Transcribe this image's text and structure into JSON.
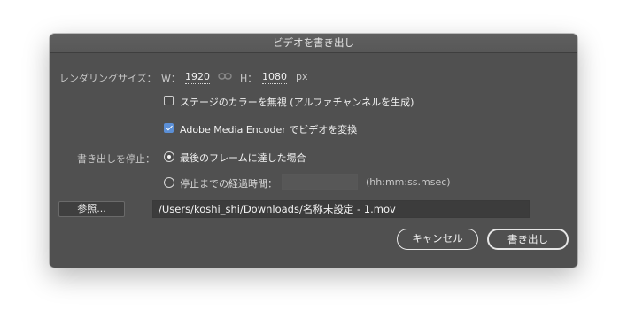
{
  "dialog": {
    "title": "ビデオを書き出し",
    "render_size": {
      "label": "レンダリングサイズ：",
      "w_label": "W：",
      "width": "1920",
      "h_label": "H：",
      "height": "1080",
      "unit": "px"
    },
    "options": {
      "stage_color": {
        "label": "ステージのカラーを無視 (アルファチャンネルを生成)",
        "checked": false
      },
      "media_encoder": {
        "label": "Adobe Media Encoder でビデオを変換",
        "checked": true
      }
    },
    "stop_export": {
      "label": "書き出しを停止：",
      "radios": [
        {
          "label": "最後のフレームに達した場合",
          "selected": true
        },
        {
          "label": "停止までの経過時間：",
          "selected": false
        }
      ],
      "time_hint": "(hh:mm:ss.msec)",
      "time_value": ""
    },
    "browse_label": "参照...",
    "file_path": "/Users/koshi_shi/Downloads/名称未設定 - 1.mov",
    "buttons": {
      "cancel": "キャンセル",
      "export": "書き出し"
    },
    "colors": {
      "dialog_bg": "#505050",
      "checkbox_accent": "#5b8fd6",
      "text": "#e8e8e8"
    },
    "icons": {
      "link": "link-icon"
    }
  }
}
